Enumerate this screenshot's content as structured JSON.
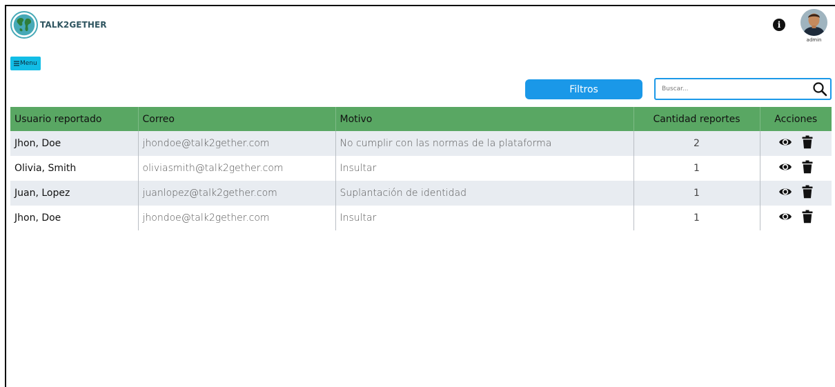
{
  "header": {
    "logo_text": "TALK2GETHER",
    "user_label": "admin",
    "icons": {
      "info": "info-circle-icon",
      "avatar": "user-avatar"
    }
  },
  "menu": {
    "label": "Menu",
    "icon": "hamburger-icon"
  },
  "toolbar": {
    "filters_label": "Filtros",
    "search_placeholder": "Buscar...",
    "search_value": "",
    "search_icon": "search-icon"
  },
  "table": {
    "columns": [
      "Usuario reportado",
      "Correo",
      "Motivo",
      "Cantidad reportes",
      "Acciones"
    ],
    "rows": [
      {
        "user": "Jhon, Doe",
        "email": "jhondoe@talk2gether.com",
        "reason": "No cumplir con las normas de la plataforma",
        "count": "2"
      },
      {
        "user": "Olivia, Smith",
        "email": "oliviasmith@talk2gether.com",
        "reason": "Insultar",
        "count": "1"
      },
      {
        "user": "Juan, Lopez",
        "email": "juanlopez@talk2gether.com",
        "reason": "Suplantación de identidad",
        "count": "1"
      },
      {
        "user": "Jhon, Doe",
        "email": "jhondoe@talk2gether.com",
        "reason": "Insultar",
        "count": "1"
      }
    ],
    "row_actions": [
      "eye-icon",
      "trash-icon"
    ]
  },
  "colors": {
    "header_green": "#59a763",
    "accent_blue": "#1a98e8",
    "menu_cyan": "#12bde6",
    "row_stripe": "#e8ecf1"
  }
}
